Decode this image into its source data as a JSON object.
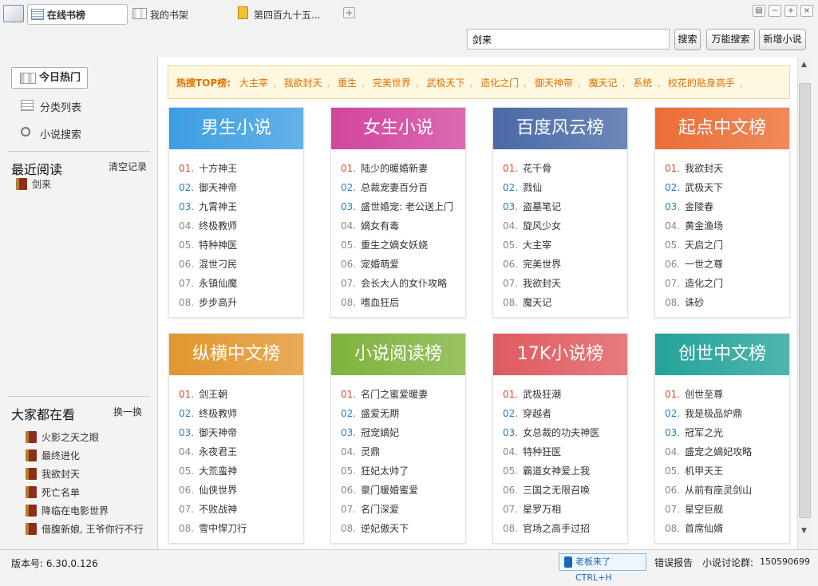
{
  "tabs": [
    "在线书榜",
    "我的书架",
    "第四百九十五..."
  ],
  "window_btns": [
    "▤",
    "−",
    "+",
    "×"
  ],
  "search": {
    "value": "剑来",
    "search_btn": "搜索",
    "power_btn": "万能搜索",
    "add_btn": "新增小说"
  },
  "sidebar": {
    "today_hot": "今日热门",
    "category": "分类列表",
    "novel_search": "小说搜索",
    "recent_title": "最近阅读",
    "clear": "清空记录",
    "recent": [
      "剑来"
    ],
    "popular_title": "大家都在看",
    "swap": "换一换",
    "popular": [
      "火影之天之眼",
      "最终进化",
      "我欲封天",
      "死亡名单",
      "降临在电影世界",
      "借腹新娘, 王爷你行不行"
    ]
  },
  "hot": {
    "label": "热搜TOP榜:",
    "items": [
      "大主宰",
      "我欲封天",
      "重生",
      "完美世界",
      "武极天下",
      "造化之门",
      "御天神帝",
      "魔天记",
      "系统",
      "校花的贴身高手"
    ]
  },
  "boards": [
    {
      "title": "男生小说",
      "color": "#3d9ee3",
      "items": [
        "十方神王",
        "御天神帝",
        "九霄神王",
        "终极教师",
        "特种神医",
        "混世刁民",
        "永镇仙魔",
        "步步高升"
      ]
    },
    {
      "title": "女生小说",
      "color": "#d2459e",
      "items": [
        "陆少的暖婚新妻",
        "总裁宠妻百分百",
        "盛世婚宠: 老公送上门",
        "嫡女有毒",
        "重生之嫡女妖娆",
        "宠婚萌爱",
        "会长大人的女仆攻略",
        "嗜血狂后"
      ]
    },
    {
      "title": "百度风云榜",
      "color": "#4a6aa6",
      "items": [
        "花千骨",
        "戮仙",
        "盗墓笔记",
        "旋风少女",
        "大主宰",
        "完美世界",
        "我欲封天",
        "魔天记"
      ]
    },
    {
      "title": "起点中文榜",
      "color": "#ec6d34",
      "items": [
        "我欲封天",
        "武极天下",
        "金陵春",
        "黄金渔场",
        "天启之门",
        "一世之尊",
        "造化之门",
        "诛砂"
      ]
    },
    {
      "title": "纵横中文榜",
      "color": "#e3962e",
      "items": [
        "剑王朝",
        "终极教师",
        "御天神帝",
        "永夜君王",
        "大荒蛮神",
        "仙侠世界",
        "不败战神",
        "雪中悍刀行"
      ]
    },
    {
      "title": "小说阅读榜",
      "color": "#7fb33c",
      "items": [
        "名门之蜜爱暖妻",
        "盛爱无期",
        "冠宠嫡妃",
        "灵鼎",
        "狂妃太帅了",
        "豪门暖婚蜜爱",
        "名门深爱",
        "逆妃傲天下"
      ]
    },
    {
      "title": "17K小说榜",
      "color": "#e05a60",
      "items": [
        "武极狂潮",
        "穿越者",
        "女总裁的功夫神医",
        "特种狂医",
        "霸道女神爱上我",
        "三国之无限召唤",
        "星罗万相",
        "官场之高手过招"
      ]
    },
    {
      "title": "创世中文榜",
      "color": "#23a39a",
      "items": [
        "创世至尊",
        "我是极品炉鼎",
        "冠军之光",
        "盛宠之嫡妃攻略",
        "机甲天王",
        "从前有座灵剑山",
        "星空巨舰",
        "首席仙婿"
      ]
    }
  ],
  "status": {
    "version": "版本号: 6.30.0.126",
    "boss": "老板来了CTRL+H",
    "report": "错误报告",
    "group": "小说讨论群:",
    "group_id": "150590699"
  }
}
